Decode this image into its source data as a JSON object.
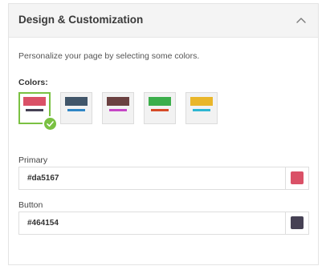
{
  "panel": {
    "title": "Design & Customization",
    "description": "Personalize your page by selecting some colors."
  },
  "colors": {
    "label": "Colors:",
    "palettes": [
      {
        "primary": "#da5167",
        "secondary": "#464154",
        "selected": true
      },
      {
        "primary": "#41566a",
        "secondary": "#2f86c6",
        "selected": false
      },
      {
        "primary": "#6b4141",
        "secondary": "#c646c6",
        "selected": false
      },
      {
        "primary": "#3cae4b",
        "secondary": "#d64a27",
        "selected": false
      },
      {
        "primary": "#e9b62a",
        "secondary": "#2db6d3",
        "selected": false
      }
    ]
  },
  "primary_field": {
    "label": "Primary",
    "value": "#da5167",
    "chip_color": "#da5167"
  },
  "button_field": {
    "label": "Button",
    "value": "#464154",
    "chip_color": "#464154"
  },
  "icons": {
    "collapse": "chevron-up-icon",
    "selected_badge": "checkmark-icon"
  },
  "accent_colors": {
    "selected_border": "#7ac142"
  }
}
